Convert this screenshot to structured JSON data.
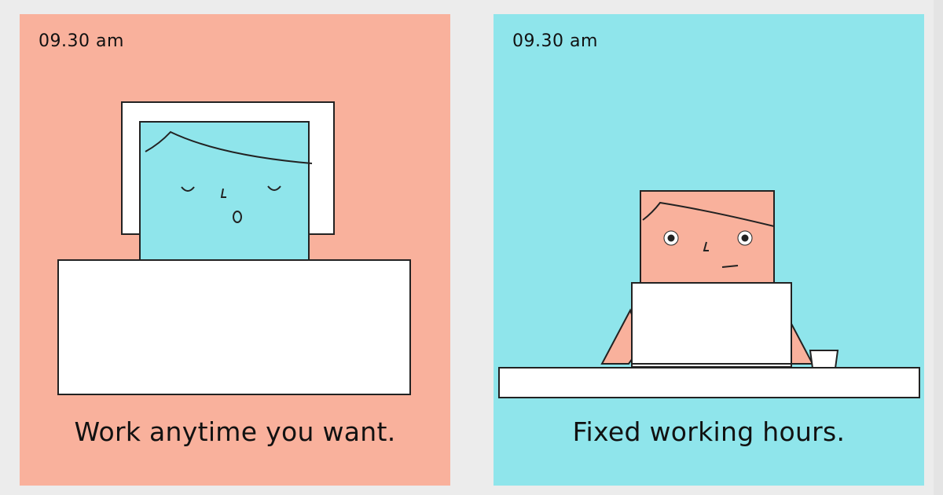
{
  "colors": {
    "page_background": "#ececec",
    "salmon": "#f9b19c",
    "aqua": "#8fe5eb",
    "outline": "#222222",
    "white": "#ffffff"
  },
  "panels": [
    {
      "time": "09.30 am",
      "caption": "Work anytime you want.",
      "background_color": "#f9b19c",
      "scene": "sleeping-in-bed"
    },
    {
      "time": "09.30 am",
      "caption": "Fixed working hours.",
      "background_color": "#8fe5eb",
      "scene": "working-at-laptop"
    }
  ]
}
